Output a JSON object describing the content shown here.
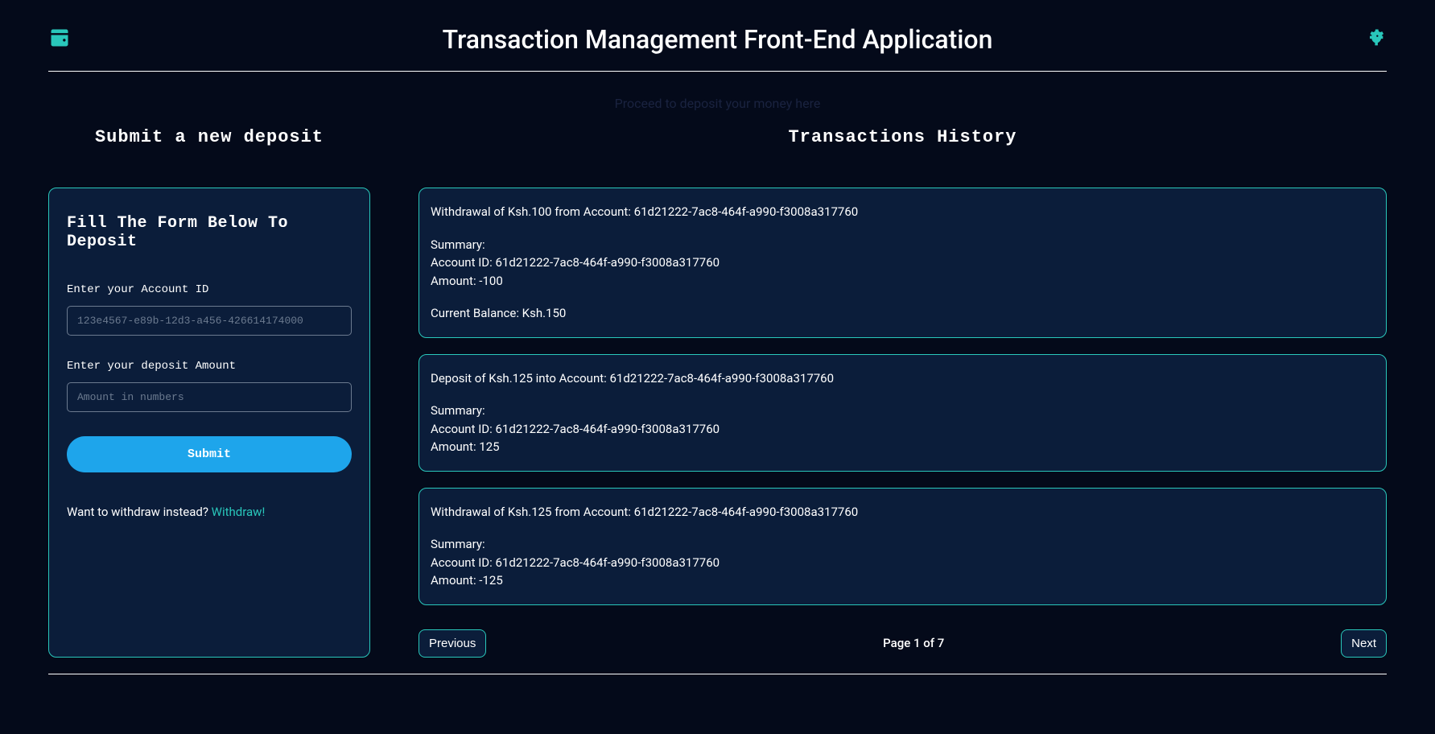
{
  "header": {
    "title": "Transaction Management Front-End Application",
    "subtitle": "Proceed to deposit your money here"
  },
  "sections": {
    "left_title": "Submit a new deposit",
    "right_title": "Transactions History"
  },
  "form": {
    "title": "Fill The Form Below To Deposit",
    "account_label": "Enter your Account ID",
    "account_placeholder": "123e4567-e89b-12d3-a456-426614174000",
    "amount_label": "Enter your deposit Amount",
    "amount_placeholder": "Amount in numbers",
    "submit_label": "Submit",
    "alt_text": "Want to withdraw instead? ",
    "alt_link": "Withdraw!"
  },
  "transactions": [
    {
      "headline": "Withdrawal of Ksh.100 from Account: 61d21222-7ac8-464f-a990-f3008a317760",
      "summary_label": "Summary:",
      "account_line": "Account ID: 61d21222-7ac8-464f-a990-f3008a317760",
      "amount_line": "Amount: -100",
      "balance_line": "Current Balance: Ksh.150"
    },
    {
      "headline": "Deposit of Ksh.125 into Account: 61d21222-7ac8-464f-a990-f3008a317760",
      "summary_label": "Summary:",
      "account_line": "Account ID: 61d21222-7ac8-464f-a990-f3008a317760",
      "amount_line": "Amount: 125",
      "balance_line": ""
    },
    {
      "headline": "Withdrawal of Ksh.125 from Account: 61d21222-7ac8-464f-a990-f3008a317760",
      "summary_label": "Summary:",
      "account_line": "Account ID: 61d21222-7ac8-464f-a990-f3008a317760",
      "amount_line": "Amount: -125",
      "balance_line": ""
    }
  ],
  "pagination": {
    "prev": "Previous",
    "next": "Next",
    "info": "Page 1 of 7"
  },
  "colors": {
    "bg": "#040a1a",
    "panel": "#0b1d3a",
    "accent": "#29c7bb",
    "button": "#1ea5eb"
  }
}
